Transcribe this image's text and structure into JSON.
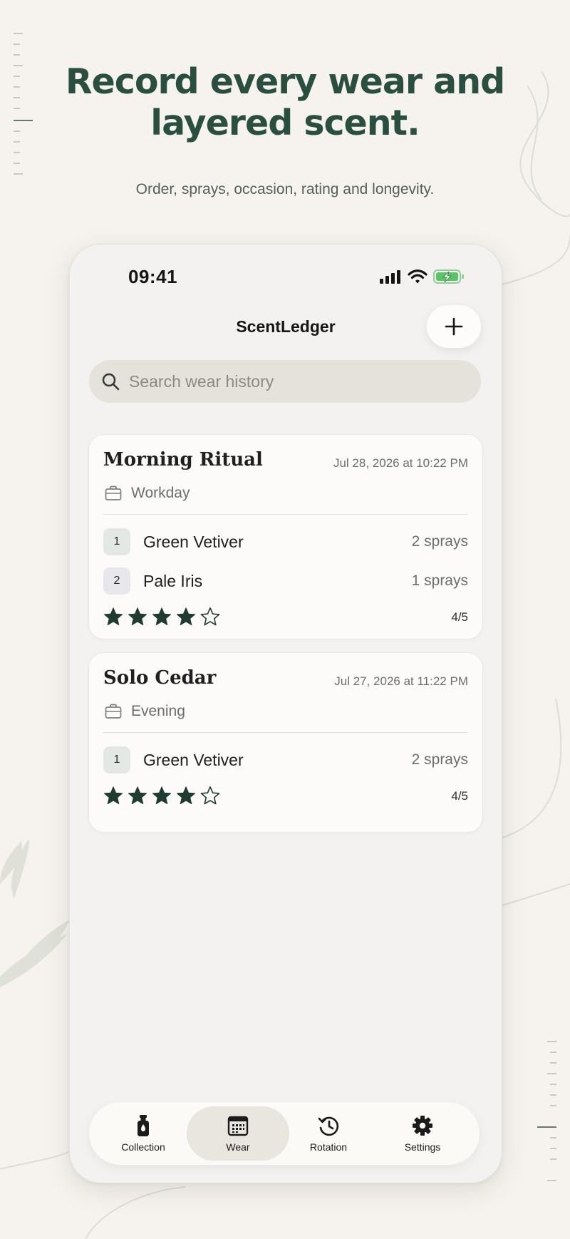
{
  "headline": {
    "line1": "Record every wear and",
    "line2": "layered scent.",
    "subtitle": "Order, sprays, occasion, rating and longevity."
  },
  "status_bar": {
    "time": "09:41"
  },
  "nav": {
    "title": "ScentLedger",
    "add_icon": "plus-icon"
  },
  "search": {
    "placeholder": "Search wear history",
    "icon": "search-icon"
  },
  "wears": [
    {
      "name": "Morning Ritual",
      "date": "Jul 28, 2026 at 10:22 PM",
      "occasion": "Workday",
      "fragrances": [
        {
          "order": "1",
          "name": "Green Vetiver",
          "sprays": "2 sprays"
        },
        {
          "order": "2",
          "name": "Pale Iris",
          "sprays": "1 sprays"
        }
      ],
      "rating_stars": 4,
      "rating_label": "4/5"
    },
    {
      "name": "Solo Cedar",
      "date": "Jul 27, 2026 at 11:22 PM",
      "occasion": "Evening",
      "fragrances": [
        {
          "order": "1",
          "name": "Green Vetiver",
          "sprays": "2 sprays"
        }
      ],
      "rating_stars": 4,
      "rating_label": "4/5"
    }
  ],
  "tabs": [
    {
      "label": "Collection",
      "icon": "bottle-icon",
      "active": false
    },
    {
      "label": "Wear",
      "icon": "calendar-icon",
      "active": true
    },
    {
      "label": "Rotation",
      "icon": "history-icon",
      "active": false
    },
    {
      "label": "Settings",
      "icon": "gear-icon",
      "active": false
    }
  ],
  "colors": {
    "accent": "#2a4e40",
    "star": "#1f3b32",
    "background": "#f6f3ee",
    "card": "#fcfbf9",
    "battery": "#5cc36b"
  }
}
